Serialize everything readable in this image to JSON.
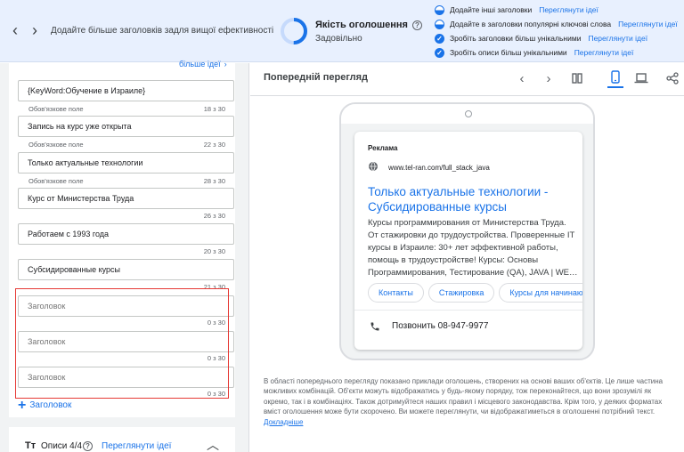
{
  "topbar": {
    "back_icon": "chevron-left-icon",
    "forward_icon": "chevron-right-icon",
    "tip_text": "Додайте більше заголовків задля вищої ефективності",
    "quality": {
      "label": "Якість оголошення",
      "value": "Задовільно",
      "level": 0.5
    },
    "suggestions": [
      {
        "text": "Додайте інші заголовки",
        "link": "Переглянути ідеї",
        "status": "partial"
      },
      {
        "text": "Додайте в заголовки популярні ключові слова",
        "link": "Переглянути ідеї",
        "status": "partial"
      },
      {
        "text": "Зробіть заголовки більш унікальними",
        "link": "Переглянути ідеї",
        "status": "done"
      },
      {
        "text": "Зробіть описи більш унікальними",
        "link": "Переглянути ідеї",
        "status": "done"
      }
    ]
  },
  "headlines": {
    "more_ideas": "більше ідеї",
    "required_label": "Обов'язкове поле",
    "placeholder": "Заголовок",
    "items": [
      {
        "value": "{KeyWord:Обучение в Израиле}",
        "count": "18 з 30",
        "required": true
      },
      {
        "value": "Запись на курс уже открыта",
        "count": "22 з 30",
        "required": true
      },
      {
        "value": "Только актуальные технологии",
        "count": "28 з 30",
        "required": true
      },
      {
        "value": "Курс от Министерства Труда",
        "count": "26 з 30",
        "required": false
      },
      {
        "value": "Работаем с 1993 года",
        "count": "20 з 30",
        "required": false
      },
      {
        "value": "Субсидированные курсы",
        "count": "21 з 30",
        "required": false
      },
      {
        "value": "",
        "count": "0 з 30",
        "required": false
      },
      {
        "value": "",
        "count": "0 з 30",
        "required": false
      },
      {
        "value": "",
        "count": "0 з 30",
        "required": false
      }
    ],
    "add_label": "Заголовок"
  },
  "descriptions": {
    "title": "Описи 4/4",
    "link": "Переглянути ідеї"
  },
  "preview": {
    "title": "Попередній перегляд",
    "ad_label": "Реклама",
    "url": "www.tel-ran.com/full_stack_java",
    "headline": "Только актуальные технологии - Субсидированные курсы",
    "description": "Курсы программирования от Министерства Труда. От стажировки до трудоустройства. Проверенные IT курсы в Израиле: 30+ лет эффективной работы, помощь в трудоустройстве! Курсы: Основы Программирования, Тестирование (QA), JAVA | WE…",
    "sitelinks": [
      "Контакты",
      "Стажировка",
      "Курсы для начинающ"
    ],
    "call": "Позвонить 08-947-9977",
    "notice": "В області попереднього перегляду показано приклади оголошень, створених на основі ваших об'єктів. Це лише частина можливих комбінацій. Об'єкти можуть відображатись у будь-якому порядку, тож переконайтеся, що вони зрозумілі як окремо, так і в комбінаціях. Також дотримуйтеся наших правил і місцевого законодавства. Крім того, у деяких форматах вміст оголошення може бути скорочено. Ви можете переглянути, чи відображатиметься в оголошенні потрібний текст.",
    "notice_link": "Докладніше"
  },
  "colors": {
    "accent": "#1a73e8",
    "highlight": "#e53935",
    "topbar_bg": "#e8f0fe"
  }
}
